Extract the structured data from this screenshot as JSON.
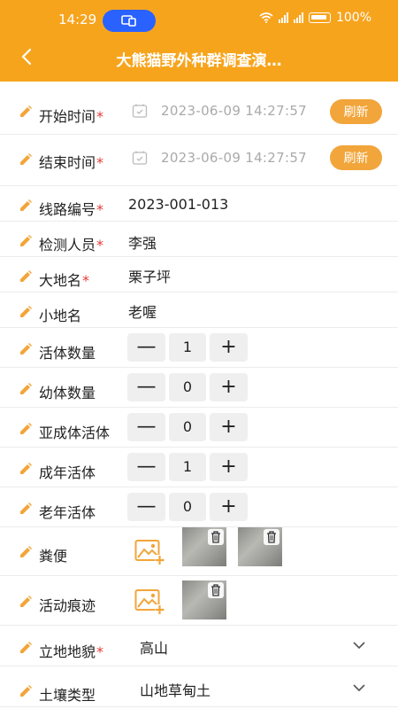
{
  "status": {
    "time": "14:29",
    "battery": "100%"
  },
  "header": {
    "title": "大熊猫野外种群调查演…",
    "accent": "#F7A41D"
  },
  "fields": {
    "start_time": {
      "label": "开始时间",
      "value": "2023-06-09 14:27:57",
      "button": "刷新"
    },
    "end_time": {
      "label": "结束时间",
      "value": "2023-06-09 14:27:57",
      "button": "刷新"
    },
    "route_no": {
      "label": "线路编号",
      "value": "2023-001-013"
    },
    "inspector": {
      "label": "检测人员",
      "value": "李强"
    },
    "big_place": {
      "label": "大地名",
      "value": "栗子坪"
    },
    "small_place": {
      "label": "小地名",
      "value": "老喔"
    },
    "live_count": {
      "label": "活体数量",
      "value": "1"
    },
    "juvenile_count": {
      "label": "幼体数量",
      "value": "0"
    },
    "subadult_count": {
      "label": "亚成体活体",
      "value": "0"
    },
    "adult_count": {
      "label": "成年活体",
      "value": "1"
    },
    "elder_count": {
      "label": "老年活体",
      "value": "0"
    },
    "feces": {
      "label": "粪便"
    },
    "traces": {
      "label": "活动痕迹"
    },
    "landform": {
      "label": "立地地貌",
      "value": "高山"
    },
    "soil": {
      "label": "土壤类型",
      "value": "山地草甸土"
    }
  },
  "stepper": {
    "minus": "—",
    "plus": "+"
  },
  "required_mark": "*",
  "colors": {
    "button": "#F2A53A",
    "required": "#e53935"
  }
}
